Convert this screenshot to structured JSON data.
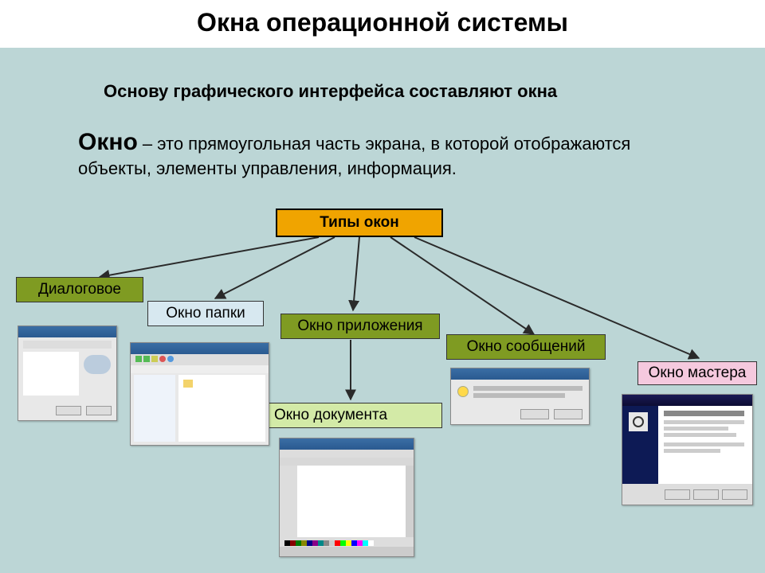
{
  "title": "Окна операционной системы",
  "intro": "Основу графического интерфейса составляют окна",
  "definition_term": "Окно",
  "definition_text": " – это прямоугольная часть экрана, в которой отображаются объекты, элементы управления, информация.",
  "root": "Типы окон",
  "nodes": {
    "dialog": "Диалоговое",
    "folder": "Окно папки",
    "app": "Окно приложения",
    "msg": "Окно сообщений",
    "wizard": "Окно мастера",
    "doc": "Окно документа"
  }
}
